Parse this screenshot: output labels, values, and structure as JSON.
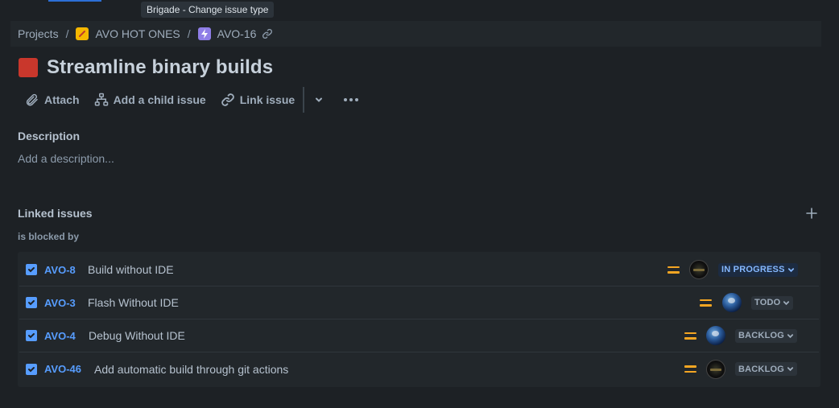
{
  "tooltip": "Brigade - Change issue type",
  "breadcrumb": {
    "projects": "Projects",
    "separator": "/",
    "project_name": "AVO HOT ONES",
    "issue_key": "AVO-16"
  },
  "issue": {
    "title": "Streamline binary builds",
    "type_color": "#c9372c"
  },
  "toolbar": {
    "attach": "Attach",
    "add_child": "Add a child issue",
    "link_issue": "Link issue"
  },
  "description": {
    "heading": "Description",
    "placeholder": "Add a description..."
  },
  "linked": {
    "heading": "Linked issues",
    "relation": "is blocked by",
    "items": [
      {
        "key": "AVO-8",
        "summary": "Build without IDE",
        "status": "IN PROGRESS",
        "avatar": "dark-avatar"
      },
      {
        "key": "AVO-3",
        "summary": "Flash Without IDE",
        "status": "TODO",
        "avatar": "earth-avatar"
      },
      {
        "key": "AVO-4",
        "summary": "Debug Without IDE",
        "status": "BACKLOG",
        "avatar": "earth-avatar"
      },
      {
        "key": "AVO-46",
        "summary": "Add automatic build through git actions",
        "status": "BACKLOG",
        "avatar": "dark-avatar"
      }
    ]
  },
  "colors": {
    "background": "#1d2125",
    "link": "#579dff",
    "priority": "#f5a623",
    "in_progress_text": "#85b8ff"
  }
}
